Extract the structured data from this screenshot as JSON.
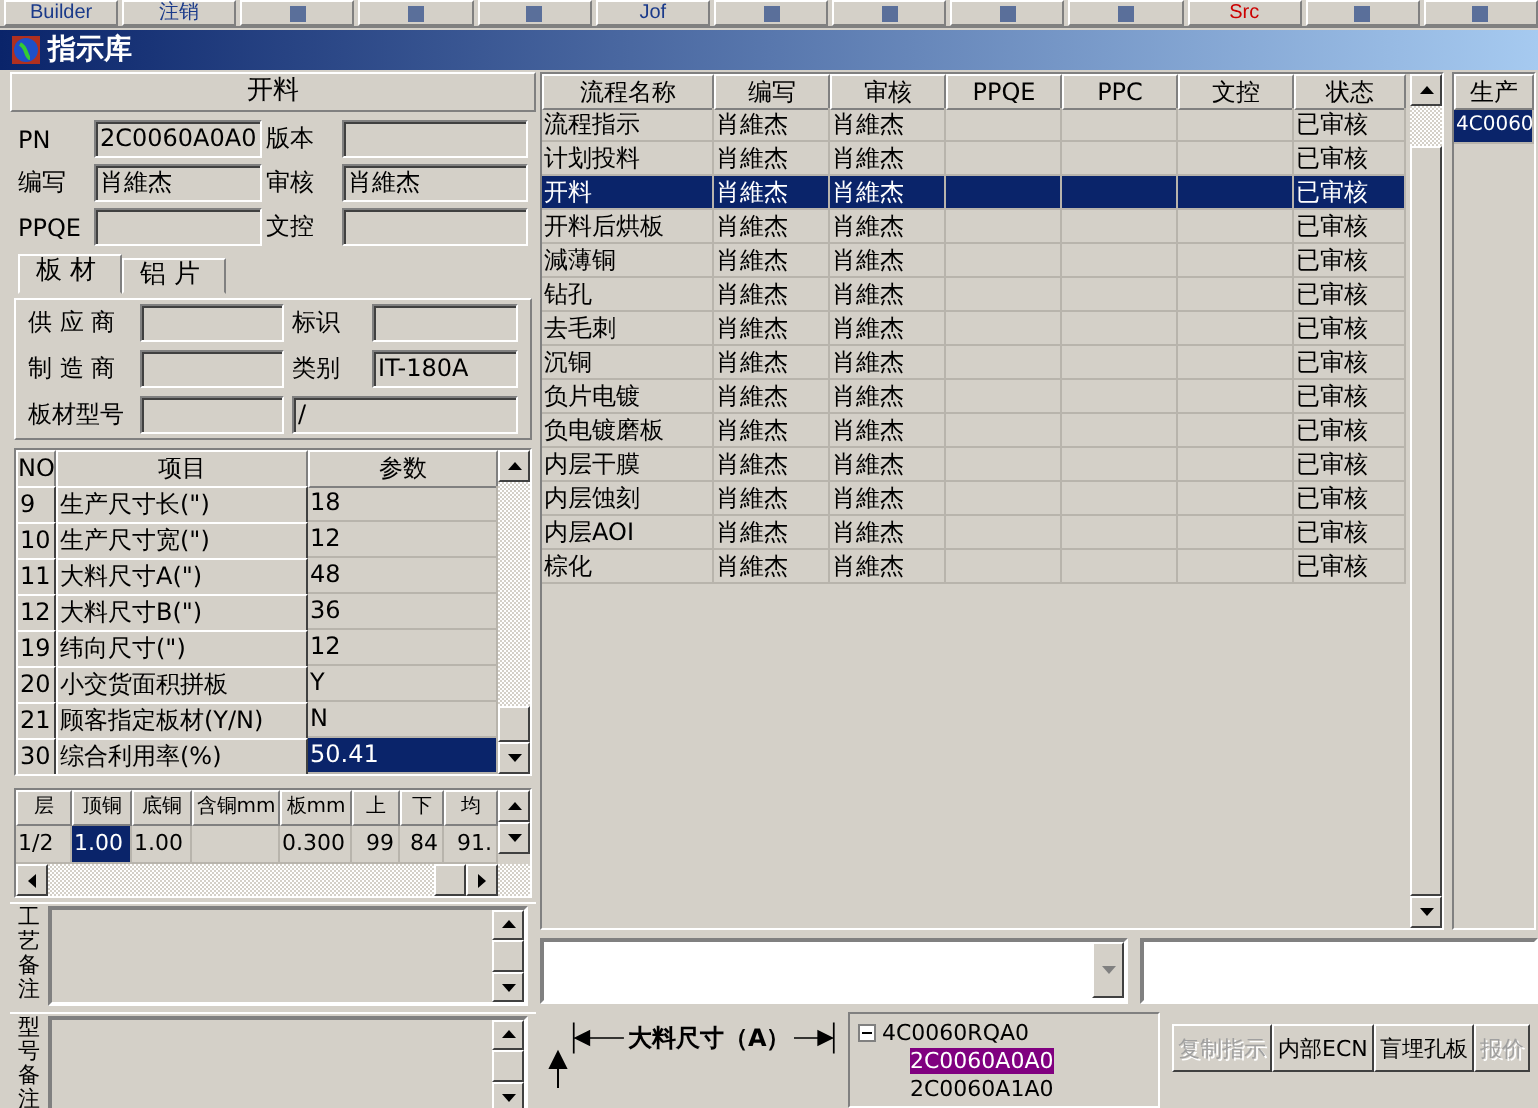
{
  "toolbar": {
    "items": [
      {
        "kind": "text",
        "label": "Builder"
      },
      {
        "kind": "text",
        "label": "注销"
      },
      {
        "kind": "icon"
      },
      {
        "kind": "icon"
      },
      {
        "kind": "icon"
      },
      {
        "kind": "text",
        "label": "Jof"
      },
      {
        "kind": "icon"
      },
      {
        "kind": "icon"
      },
      {
        "kind": "icon"
      },
      {
        "kind": "icon"
      },
      {
        "kind": "text",
        "label": "Src"
      },
      {
        "kind": "icon"
      },
      {
        "kind": "icon"
      }
    ]
  },
  "window": {
    "title": "指示库"
  },
  "section_header": "开料",
  "fields": [
    {
      "label": "PN",
      "value": "2C0060A0A0"
    },
    {
      "label": "版本"
    },
    {
      "label": "编写",
      "value": "肖維杰"
    },
    {
      "label": "审核",
      "value": "肖維杰"
    },
    {
      "label": "PPQE"
    },
    {
      "label": "文控"
    }
  ],
  "material_tabs": [
    {
      "label": "板材",
      "selected": true
    },
    {
      "label": "铝片",
      "selected": false
    }
  ],
  "material_fields": [
    {
      "label": "供 应 商"
    },
    {
      "label": "标识"
    },
    {
      "label": "制 造 商"
    },
    {
      "label": "类别",
      "value": "IT-180A"
    }
  ],
  "board_model": {
    "label": "板材型号",
    "value_2": "/"
  },
  "params": {
    "columns": [
      "NO",
      "项目",
      "参数"
    ],
    "rows": [
      {
        "no": "9",
        "item": "生产尺寸长(\")",
        "value": "18",
        "selected": false
      },
      {
        "no": "10",
        "item": "生产尺寸宽(\")",
        "value": "12",
        "selected": false
      },
      {
        "no": "11",
        "item": "大料尺寸A(\")",
        "value": "48",
        "selected": false
      },
      {
        "no": "12",
        "item": "大料尺寸B(\")",
        "value": "36",
        "selected": false
      },
      {
        "no": "19",
        "item": "纬向尺寸(\")",
        "value": "12",
        "selected": false
      },
      {
        "no": "20",
        "item": "小交货面积拼板",
        "value": "Y",
        "selected": false
      },
      {
        "no": "21",
        "item": "顾客指定板材(Y/N)",
        "value": "N",
        "selected": false
      },
      {
        "no": "30",
        "item": "综合利用率(%)",
        "value": "50.41",
        "selected": true
      }
    ]
  },
  "layers": {
    "columns": [
      "层",
      "顶铜",
      "底铜",
      "含铜mm",
      "板mm",
      "上",
      "下",
      "均"
    ],
    "rows": [
      {
        "cells": [
          {
            "text": "1/2",
            "selected": false
          },
          {
            "text": "1.00",
            "selected": true
          },
          {
            "text": "1.00",
            "selected": false
          },
          {
            "selected": false
          },
          {
            "text": "0.300",
            "selected": false
          },
          {
            "text": "99",
            "selected": false
          },
          {
            "text": "84",
            "selected": false
          },
          {
            "text": "91.",
            "selected": false
          }
        ]
      }
    ]
  },
  "notes": [
    {
      "label": "工艺备注"
    },
    {
      "label": "型号备注"
    }
  ],
  "process": {
    "columns": [
      "流程名称",
      "编写",
      "审核",
      "PPQE",
      "PPC",
      "文控",
      "状态"
    ],
    "rows": [
      {
        "name": "流程指示",
        "writer": "肖維杰",
        "reviewer": "肖維杰",
        "status": "已审核",
        "selected": false
      },
      {
        "name": "计划投料",
        "writer": "肖維杰",
        "reviewer": "肖維杰",
        "status": "已审核",
        "selected": false
      },
      {
        "name": "开料",
        "writer": "肖維杰",
        "reviewer": "肖維杰",
        "status": "已审核",
        "selected": true
      },
      {
        "name": "开料后烘板",
        "writer": "肖維杰",
        "reviewer": "肖維杰",
        "status": "已审核",
        "selected": false
      },
      {
        "name": "減薄铜",
        "writer": "肖維杰",
        "reviewer": "肖維杰",
        "status": "已审核",
        "selected": false
      },
      {
        "name": "钻孔",
        "writer": "肖維杰",
        "reviewer": "肖維杰",
        "status": "已审核",
        "selected": false
      },
      {
        "name": "去毛刺",
        "writer": "肖維杰",
        "reviewer": "肖維杰",
        "status": "已审核",
        "selected": false
      },
      {
        "name": "沉铜",
        "writer": "肖維杰",
        "reviewer": "肖維杰",
        "status": "已审核",
        "selected": false
      },
      {
        "name": "负片电镀",
        "writer": "肖維杰",
        "reviewer": "肖維杰",
        "status": "已审核",
        "selected": false
      },
      {
        "name": "负电镀磨板",
        "writer": "肖維杰",
        "reviewer": "肖維杰",
        "status": "已审核",
        "selected": false
      },
      {
        "name": "内层干膜",
        "writer": "肖維杰",
        "reviewer": "肖維杰",
        "status": "已审核",
        "selected": false
      },
      {
        "name": "内层蚀刻",
        "writer": "肖維杰",
        "reviewer": "肖維杰",
        "status": "已审核",
        "selected": false
      },
      {
        "name": "内层AOI",
        "writer": "肖維杰",
        "reviewer": "肖維杰",
        "status": "已审核",
        "selected": false
      },
      {
        "name": "棕化",
        "writer": "肖維杰",
        "reviewer": "肖維杰",
        "status": "已审核",
        "selected": false
      }
    ]
  },
  "production": {
    "header": "生产",
    "rows": [
      {
        "text": "4C0060",
        "selected": true
      }
    ]
  },
  "diagram": {
    "label": "大料尺寸（A）"
  },
  "tree": {
    "nodes": [
      {
        "label": "4C0060RQA0",
        "expanded": true,
        "selected": false,
        "children": [
          {
            "label": "2C0060A0A0",
            "selected": true
          },
          {
            "label": "2C0060A1A0",
            "selected": false
          }
        ]
      }
    ]
  },
  "actions": [
    {
      "label": "复制指示",
      "disabled": true
    },
    {
      "label": "内部ECN",
      "disabled": false
    },
    {
      "label": "盲埋孔板",
      "disabled": false
    },
    {
      "label": "报价",
      "disabled": true
    }
  ]
}
